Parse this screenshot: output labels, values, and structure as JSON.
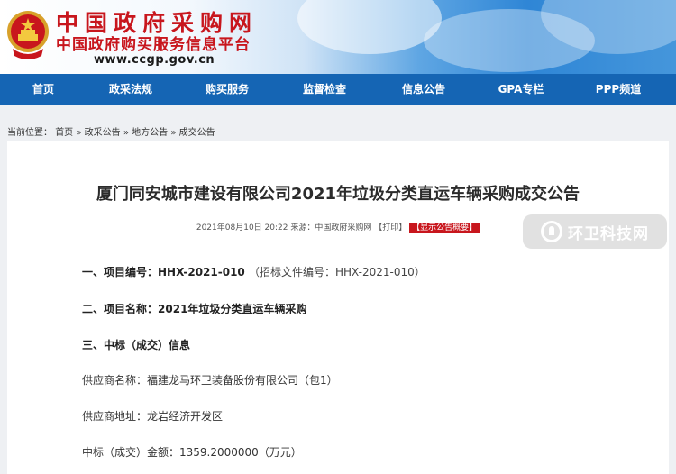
{
  "header": {
    "site_name": "中国政府采购网",
    "site_subname": "中国政府购买服务信息平台",
    "site_url": "www.ccgp.gov.cn"
  },
  "nav": {
    "items": [
      "首页",
      "政采法规",
      "购买服务",
      "监督检查",
      "信息公告",
      "GPA专栏",
      "PPP频道"
    ]
  },
  "breadcrumb": {
    "prefix": "当前位置：",
    "items": [
      "首页",
      "政采公告",
      "地方公告",
      "成交公告"
    ],
    "separator": " » "
  },
  "article": {
    "title": "厦门同安城市建设有限公司2021年垃圾分类直运车辆采购成交公告",
    "date": "2021年08月10日 20:22",
    "source": "来源：中国政府采购网",
    "print_label": "【打印】",
    "summary_label": "【显示公告概要】",
    "s1_label": "一、项目编号：",
    "s1_value": "HHX-2021-010",
    "s1_note": "（招标文件编号：HHX-2021-010）",
    "s2_label": "二、项目名称：",
    "s2_value": "2021年垃圾分类直运车辆采购",
    "s3_label": "三、中标（成交）信息",
    "supplier_name": "供应商名称：福建龙马环卫装备股份有限公司（包1）",
    "supplier_addr": "供应商地址：龙岩经济开发区",
    "amount": "中标（成交）金额：1359.2000000（万元）"
  },
  "watermark": {
    "text": "环卫科技网"
  },
  "colors": {
    "nav_bg": "#1565b4",
    "brand_red": "#c8161d",
    "page_bg": "#eef0f3"
  }
}
